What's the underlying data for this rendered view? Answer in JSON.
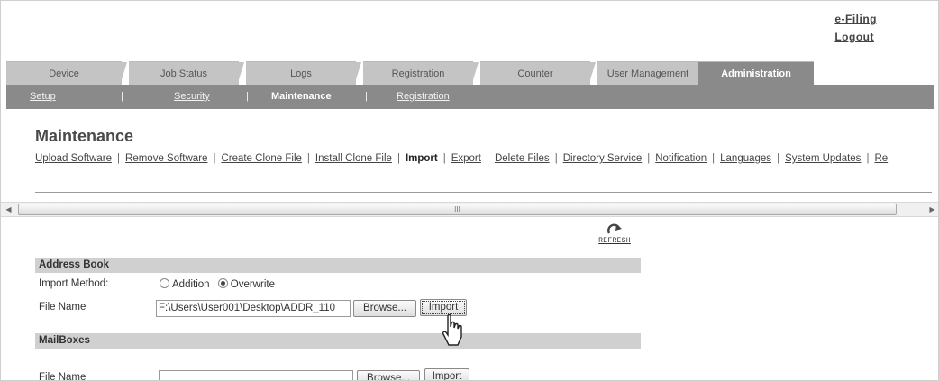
{
  "header": {
    "links": [
      "e-Filing",
      "Logout"
    ]
  },
  "tabs": [
    {
      "label": "Device"
    },
    {
      "label": "Job Status"
    },
    {
      "label": "Logs"
    },
    {
      "label": "Registration"
    },
    {
      "label": "Counter"
    },
    {
      "label": "User Management"
    },
    {
      "label": "Administration"
    }
  ],
  "subnav": {
    "items": [
      "Setup",
      "Security",
      "Maintenance",
      "Registration"
    ],
    "active": "Maintenance"
  },
  "page": {
    "title": "Maintenance",
    "menu": [
      "Upload Software",
      "Remove Software",
      "Create Clone File",
      "Install Clone File",
      "Import",
      "Export",
      "Delete Files",
      "Directory Service",
      "Notification",
      "Languages",
      "System Updates",
      "Re"
    ],
    "active_menu": "Import"
  },
  "scrollbar": {
    "thumb_grip": "III"
  },
  "refresh": {
    "label": "REFRESH"
  },
  "address_book": {
    "header": "Address Book",
    "import_method_label": "Import Method:",
    "options": [
      "Addition",
      "Overwrite"
    ],
    "selected": "Overwrite",
    "file_label": "File Name",
    "file_value": "F:\\Users\\User001\\Desktop\\ADDR_110",
    "browse_label": "Browse...",
    "import_label": "Import"
  },
  "mailboxes": {
    "header": "MailBoxes",
    "file_label": "File Name",
    "file_value": "",
    "browse_label": "Browse...",
    "import_label": "Import"
  }
}
